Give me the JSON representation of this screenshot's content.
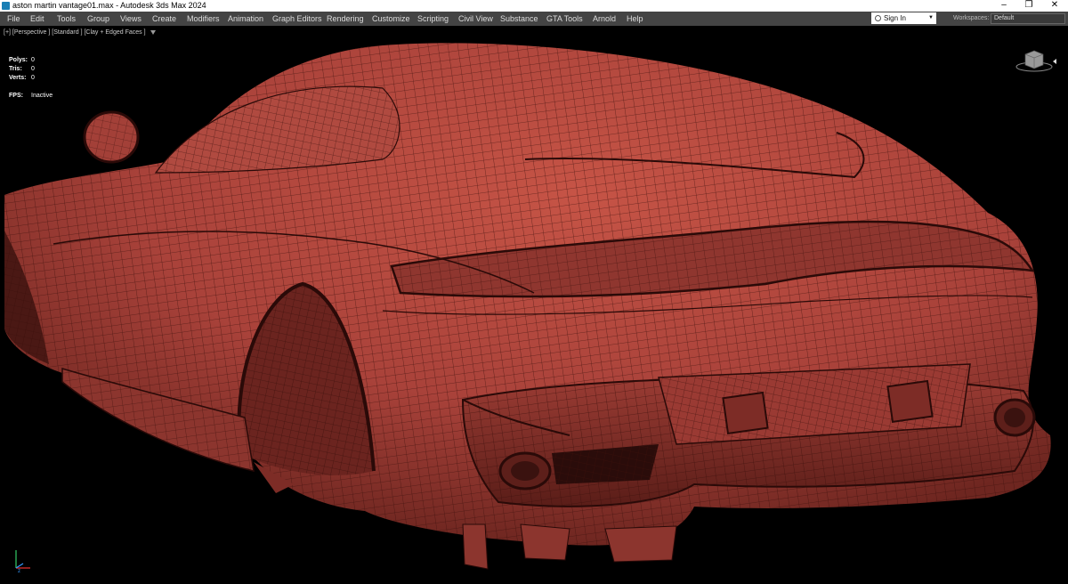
{
  "window": {
    "title": "aston martin vantage01.max - Autodesk 3ds Max 2024",
    "minimize_glyph": "–",
    "restore_glyph": "❐",
    "close_glyph": "✕"
  },
  "menu": {
    "items": [
      "File",
      "Edit",
      "Tools",
      "Group",
      "Views",
      "Create",
      "Modifiers",
      "Animation",
      "Graph Editors",
      "Rendering",
      "Customize",
      "Scripting",
      "Civil View",
      "Substance",
      "GTA Tools",
      "Arnold",
      "Help"
    ],
    "sign_in": "Sign In",
    "workspaces_label": "Workspaces:",
    "workspace_value": "Default"
  },
  "viewport": {
    "label": "[+] [Perspective ] [Standard ] [Clay + Edged Faces ]",
    "stats": {
      "polys_label": "Polys:",
      "polys": "0",
      "tris_label": "Tris:",
      "tris": "0",
      "verts_label": "Verts:",
      "verts": "0",
      "fps_label": "FPS:",
      "fps": "Inactive"
    },
    "mesh_color": "#b8473d",
    "wire_color": "#3a0f0b"
  },
  "icons": {
    "app": "3ds-max-icon",
    "filter": "filter-icon",
    "viewcube": "viewcube-icon",
    "axis": "axis-tripod-icon"
  }
}
